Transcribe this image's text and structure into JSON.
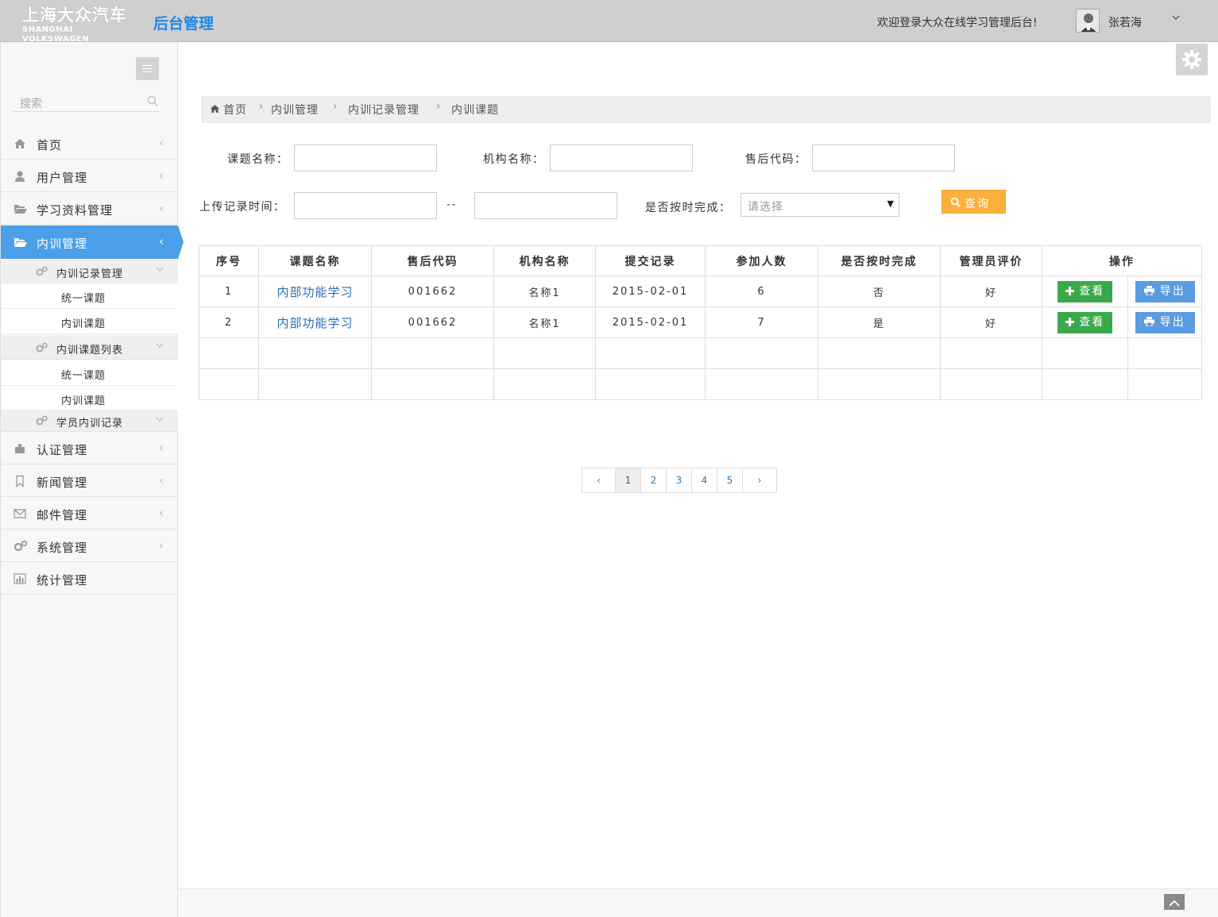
{
  "header": {
    "logo_cn": "上海大众汽车",
    "logo_en": "SHANGHAI VOLKSWAGEN",
    "app_title": "后台管理",
    "welcome": "欢迎登录大众在线学习管理后台!",
    "username": "张若海"
  },
  "sidebar": {
    "search_placeholder": "搜索",
    "items": [
      {
        "label": "首页",
        "icon": "home-icon"
      },
      {
        "label": "用户管理",
        "icon": "user-icon"
      },
      {
        "label": "学习资料管理",
        "icon": "folder-open-icon"
      },
      {
        "label": "内训管理",
        "icon": "folder-open-icon",
        "active": true
      },
      {
        "label": "认证管理",
        "icon": "puzzle-icon"
      },
      {
        "label": "新闻管理",
        "icon": "bookmark-icon"
      },
      {
        "label": "邮件管理",
        "icon": "envelope-icon"
      },
      {
        "label": "系统管理",
        "icon": "cogs-icon"
      },
      {
        "label": "统计管理",
        "icon": "bar-chart-icon"
      }
    ],
    "sub": {
      "group1": "内训记录管理",
      "group1_items": [
        "统一课题",
        "内训课题"
      ],
      "group2": "内训课题列表",
      "group2_items": [
        "统一课题",
        "内训课题"
      ],
      "group3": "学员内训记录"
    }
  },
  "breadcrumb": [
    "首页",
    "内训管理",
    "内训记录管理",
    "内训课题"
  ],
  "filters": {
    "topic_label": "课题名称：",
    "org_label": "机构名称：",
    "code_label": "售后代码：",
    "upload_time_label": "上传记录时间：",
    "range_sep": "--",
    "ontime_label": "是否按时完成：",
    "ontime_placeholder": "请选择",
    "query_label": "查询"
  },
  "table": {
    "headers": [
      "序号",
      "课题名称",
      "售后代码",
      "机构名称",
      "提交记录",
      "参加人数",
      "是否按时完成",
      "管理员评价",
      "操作"
    ],
    "rows": [
      {
        "no": "1",
        "topic": "内部功能学习",
        "code": "001662",
        "org": "名称1",
        "date": "2015-02-01",
        "count": "6",
        "ontime": "否",
        "eval": "好"
      },
      {
        "no": "2",
        "topic": "内部功能学习",
        "code": "001662",
        "org": "名称1",
        "date": "2015-02-01",
        "count": "7",
        "ontime": "是",
        "eval": "好"
      }
    ],
    "view_label": "查看",
    "export_label": "导出"
  },
  "pagination": {
    "prev": "‹",
    "next": "›",
    "pages": [
      "1",
      "2",
      "3",
      "4",
      "5"
    ],
    "current": "1"
  },
  "colors": {
    "header_bg": "#cfcfcf",
    "brand_blue": "#1e88e5",
    "active_nav": "#4a9fe8",
    "query_orange": "#fbb03b",
    "view_green": "#3aa94b",
    "export_blue": "#5b9be0"
  }
}
